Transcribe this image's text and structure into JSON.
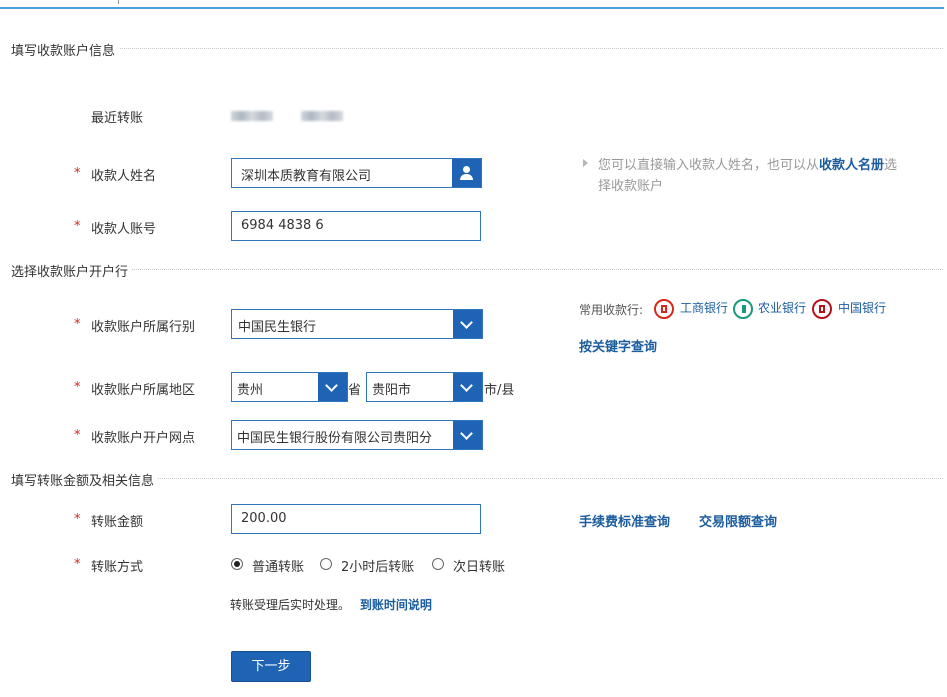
{
  "sections": {
    "payee_info": "填写收款账户信息",
    "payee_bank": "选择收款账户开户行",
    "transfer_info": "填写转账金额及相关信息"
  },
  "recent": {
    "label": "最近转账"
  },
  "payee_name": {
    "required_mark": "*",
    "label": "收款人姓名",
    "value": "深圳本质教育有限公司"
  },
  "payee_account": {
    "required_mark": "*",
    "label": "收款人账号",
    "value": "6984 4838 6"
  },
  "hint": {
    "prefix": "您可以直接输入收款人姓名，也可以从",
    "link": "收款人名册",
    "suffix": "选择收款账户"
  },
  "bank_select": {
    "required_mark": "*",
    "label": "收款账户所属行别",
    "value": "中国民生银行"
  },
  "common_banks": {
    "label": "常用收款行:",
    "items": [
      "工商银行",
      "农业银行",
      "中国银行"
    ],
    "keyword_search": "按关键字查询"
  },
  "region": {
    "required_mark": "*",
    "label": "收款账户所属地区",
    "province": "贵州",
    "province_suffix": "省",
    "city": "贵阳市",
    "city_suffix": "市/县"
  },
  "branch": {
    "required_mark": "*",
    "label": "收款账户开户网点",
    "value": "中国民生银行股份有限公司贵阳分"
  },
  "amount": {
    "required_mark": "*",
    "label": "转账金额",
    "value": "200.00",
    "fee_link": "手续费标准查询",
    "limit_link": "交易限额查询"
  },
  "method": {
    "required_mark": "*",
    "label": "转账方式",
    "options": [
      "普通转账",
      "2小时后转账",
      "次日转账"
    ],
    "selected": "普通转账"
  },
  "note": {
    "text": "转账受理后实时处理。",
    "link": "到账时间说明"
  },
  "next_button": "下一步",
  "colors": {
    "accent": "#1f64b4",
    "link": "#1b5c9e",
    "required": "#d9261c",
    "icbc": "#d9261c",
    "abc": "#179a7a",
    "boc": "#b5121b"
  }
}
